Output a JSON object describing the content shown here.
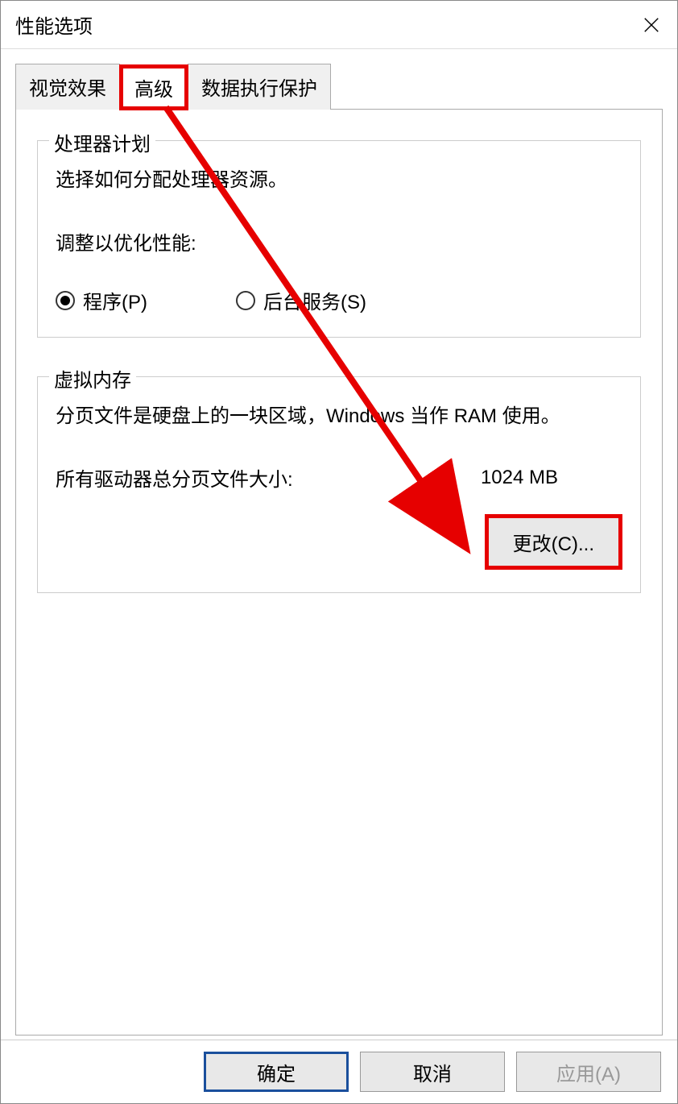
{
  "window": {
    "title": "性能选项"
  },
  "tabs": {
    "visual": "视觉效果",
    "advanced": "高级",
    "dep": "数据执行保护"
  },
  "processor": {
    "legend": "处理器计划",
    "desc": "选择如何分配处理器资源。",
    "adjust": "调整以优化性能:",
    "programs": "程序(P)",
    "background": "后台服务(S)"
  },
  "vm": {
    "legend": "虚拟内存",
    "desc": "分页文件是硬盘上的一块区域，Windows 当作 RAM 使用。",
    "total_label": "所有驱动器总分页文件大小:",
    "total_value": "1024 MB",
    "change": "更改(C)..."
  },
  "buttons": {
    "ok": "确定",
    "cancel": "取消",
    "apply": "应用(A)"
  }
}
